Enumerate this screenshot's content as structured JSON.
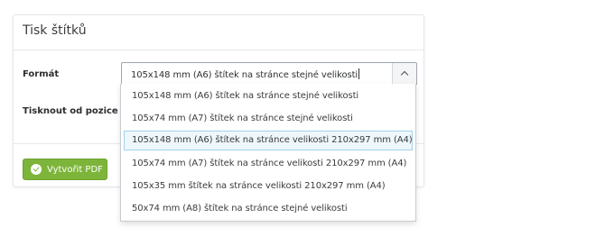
{
  "panel": {
    "title": "Tisk štítků"
  },
  "form": {
    "format_label": "Formát",
    "position_label": "Tisknout od pozice",
    "select_value": "105x148 mm (A6) štítek na stránce stejné velikosti",
    "options": [
      {
        "label": "105x148 mm (A6) štítek na stránce stejné velikosti",
        "highlighted": false
      },
      {
        "label": "105x74 mm (A7) štítek na stránce stejné velikosti",
        "highlighted": false
      },
      {
        "label": "105x148 mm (A6) štítek na stránce velikosti 210x297 mm (A4)",
        "highlighted": true
      },
      {
        "label": "105x74 mm (A7) štítek na stránce velikosti 210x297 mm (A4)",
        "highlighted": false
      },
      {
        "label": "105x35 mm štítek na stránce velikosti 210x297 mm (A4)",
        "highlighted": false
      },
      {
        "label": "50x74 mm (A8) štítek na stránce stejné velikosti",
        "highlighted": false
      }
    ]
  },
  "actions": {
    "create_pdf_label": "Vytvořit PDF"
  },
  "icons": {
    "select_toggle": "chevron-up-icon",
    "pdf_button": "check-circle-icon"
  },
  "colors": {
    "button_green": "#7db43a",
    "highlight_border": "#9fd3ea",
    "highlight_bg": "#eef7fb"
  }
}
